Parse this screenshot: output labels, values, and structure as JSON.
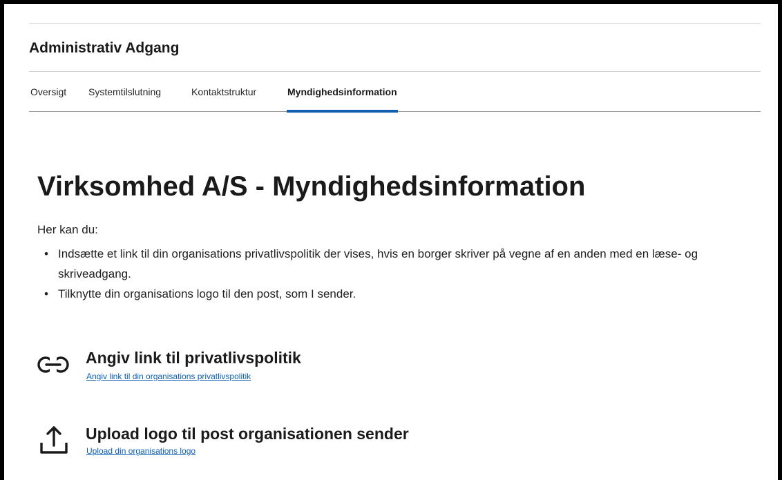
{
  "header": {
    "title": "Administrativ Adgang"
  },
  "tabs": [
    {
      "label": "Oversigt",
      "active": false
    },
    {
      "label": "Systemtilslutning",
      "active": false
    },
    {
      "label": "Kontaktstruktur",
      "active": false
    },
    {
      "label": "Myndighedsinformation",
      "active": true
    }
  ],
  "main": {
    "title": "Virksomhed A/S - Myndighedsinformation",
    "intro": "Her kan du:",
    "bullets": [
      "Indsætte et link til din organisations privatlivspolitik der vises, hvis en borger skriver på vegne af en anden med en læse- og skriveadgang.",
      "Tilknytte din organisations logo til den post, som I sender."
    ],
    "actions": [
      {
        "icon": "link-icon",
        "heading": "Angiv link til privatlivspolitik",
        "link": "Angiv link til din organisations privatlivspolitik"
      },
      {
        "icon": "upload-icon",
        "heading": "Upload logo til post organisationen sender",
        "link": "Upload din organisations logo"
      }
    ]
  },
  "colors": {
    "accent": "#0c5fb3",
    "text": "#1a1a1a",
    "divider": "#cfcfcf"
  }
}
